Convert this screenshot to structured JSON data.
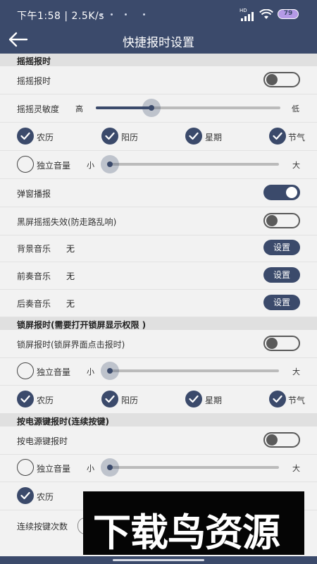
{
  "status_bar": {
    "time_speed": "下午1:58 | 2.5K/s",
    "network_label": "HD",
    "battery": "79"
  },
  "app_bar": {
    "title": "快捷报时设置"
  },
  "shake": {
    "section_title": "摇摇报时",
    "toggle": {
      "label": "摇摇报时",
      "on": false
    },
    "sensitivity": {
      "label": "摇摇灵敏度",
      "high": "高",
      "low": "低",
      "level": 0.3
    },
    "options": [
      {
        "label": "农历",
        "checked": true
      },
      {
        "label": "阳历",
        "checked": true
      },
      {
        "label": "星期",
        "checked": true
      },
      {
        "label": "节气",
        "checked": true
      }
    ],
    "volume": {
      "label": "独立音量",
      "checked": false,
      "min": "小",
      "max": "大",
      "level": 0.0
    },
    "popup": {
      "label": "弹窗播报",
      "on": true
    },
    "screen_off": {
      "label": "黑屏摇摇失效(防走路乱响)",
      "on": false
    },
    "bg_music": {
      "label": "背景音乐",
      "value": "无",
      "button": "设置"
    },
    "pre_music": {
      "label": "前奏音乐",
      "value": "无",
      "button": "设置"
    },
    "post_music": {
      "label": "后奏音乐",
      "value": "无",
      "button": "设置"
    }
  },
  "lockscreen": {
    "section_title": "锁屏报时(需要打开锁屏显示权限 )",
    "toggle": {
      "label": "锁屏报时(锁屏界面点击报时)",
      "on": false
    },
    "volume": {
      "label": "独立音量",
      "checked": false,
      "min": "小",
      "max": "大",
      "level": 0.0
    },
    "options": [
      {
        "label": "农历",
        "checked": true
      },
      {
        "label": "阳历",
        "checked": true
      },
      {
        "label": "星期",
        "checked": true
      },
      {
        "label": "节气",
        "checked": true
      }
    ]
  },
  "power_key": {
    "section_title": "按电源键报时(连续按键)",
    "toggle": {
      "label": "按电源键报时",
      "on": false
    },
    "volume": {
      "label": "独立音量",
      "checked": false,
      "min": "小",
      "max": "大",
      "level": 0.0
    },
    "options": [
      {
        "label": "农历",
        "checked": true
      }
    ],
    "press_count": {
      "label": "连续按键次数"
    }
  },
  "watermark": {
    "text": "下载鸟资源"
  },
  "colors": {
    "primary": "#3b4a6b",
    "background": "#f2f2f2",
    "section": "#e0e0e0"
  }
}
